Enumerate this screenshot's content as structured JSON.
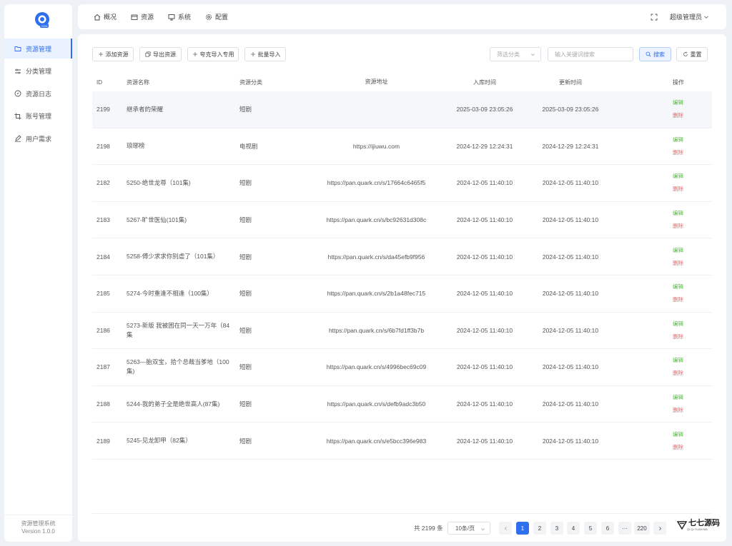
{
  "sidebar": {
    "logo_text": "CEM",
    "items": [
      {
        "label": "资源管理",
        "active": true
      },
      {
        "label": "分类管理",
        "active": false
      },
      {
        "label": "资源日志",
        "active": false
      },
      {
        "label": "账号管理",
        "active": false
      },
      {
        "label": "用户需求",
        "active": false
      }
    ],
    "footer_title": "资源管理系统",
    "footer_version": "Version 1.0.0"
  },
  "topbar": {
    "tabs": [
      {
        "label": "概况",
        "icon": "home-icon"
      },
      {
        "label": "资源",
        "icon": "box-icon"
      },
      {
        "label": "系统",
        "icon": "monitor-icon"
      },
      {
        "label": "配置",
        "icon": "gear-icon"
      }
    ],
    "user": "超级管理员"
  },
  "toolbar": {
    "add": "添加资源",
    "export": "导出资源",
    "import_special": "夸克导入专用",
    "batch_import": "批量导入",
    "category_placeholder": "筛选分类",
    "keyword_placeholder": "输入关键词搜索",
    "search": "搜索",
    "reset": "重置"
  },
  "table": {
    "headers": [
      "ID",
      "资源名称",
      "资源分类",
      "资源地址",
      "入库时间",
      "更新时间",
      "操作"
    ],
    "edit_label": "编辑",
    "delete_label": "删除",
    "rows": [
      {
        "id": "2199",
        "name": "继承者的荣耀",
        "category": "短剧",
        "url": "",
        "created": "2025-03-09 23:05:26",
        "updated": "2025-03-09 23:05:26"
      },
      {
        "id": "2198",
        "name": "琅琊榜",
        "category": "电视剧",
        "url": "https://ijiuwu.com",
        "created": "2024-12-29 12:24:31",
        "updated": "2024-12-29 12:24:31"
      },
      {
        "id": "2182",
        "name": "5250-绝世龙尊（101集)",
        "category": "短剧",
        "url": "https://pan.quark.cn/s/17664c6465f5",
        "created": "2024-12-05 11:40:10",
        "updated": "2024-12-05 11:40:10"
      },
      {
        "id": "2183",
        "name": "5267-旷世医仙(101集)",
        "category": "短剧",
        "url": "https://pan.quark.cn/s/bc92631d308c",
        "created": "2024-12-05 11:40:10",
        "updated": "2024-12-05 11:40:10"
      },
      {
        "id": "2184",
        "name": "5258-傅少求求你别虐了（101集）",
        "category": "短剧",
        "url": "https://pan.quark.cn/s/da45efb9f956",
        "created": "2024-12-05 11:40:10",
        "updated": "2024-12-05 11:40:10"
      },
      {
        "id": "2185",
        "name": "5274-今时重逢不相逢（100集）",
        "category": "短剧",
        "url": "https://pan.quark.cn/s/2b1a48fec715",
        "created": "2024-12-05 11:40:10",
        "updated": "2024-12-05 11:40:10"
      },
      {
        "id": "2186",
        "name": "5273-新版 我被困在同一天一万年（84集",
        "category": "短剧",
        "url": "https://pan.quark.cn/s/6b7fd1ff3b7b",
        "created": "2024-12-05 11:40:10",
        "updated": "2024-12-05 11:40:10"
      },
      {
        "id": "2187",
        "name": "5263—胎双宝，拾个总裁当爹地（100集)",
        "category": "短剧",
        "url": "https://pan.quark.cn/s/4996bec69c09",
        "created": "2024-12-05 11:40:10",
        "updated": "2024-12-05 11:40:10"
      },
      {
        "id": "2188",
        "name": "5244-我的弟子全是绝世高人(87集)",
        "category": "短剧",
        "url": "https://pan.quark.cn/s/defb9adc3b50",
        "created": "2024-12-05 11:40:10",
        "updated": "2024-12-05 11:40:10"
      },
      {
        "id": "2189",
        "name": "5245-见龙卸甲（82集）",
        "category": "短剧",
        "url": "https://pan.quark.cn/s/e5bcc396e983",
        "created": "2024-12-05 11:40:10",
        "updated": "2024-12-05 11:40:10"
      }
    ]
  },
  "pagination": {
    "total": "共 2199 条",
    "page_size": "10条/页",
    "pages": [
      "1",
      "2",
      "3",
      "4",
      "5",
      "6",
      "···",
      "220"
    ],
    "current": "1"
  },
  "watermark": {
    "text": "七七源码",
    "sub": "QI QI YUAN MA"
  },
  "colors": {
    "accent": "#2f6fed",
    "edit": "#5bb349",
    "delete": "#e56b6b",
    "background": "#eef1f6"
  }
}
